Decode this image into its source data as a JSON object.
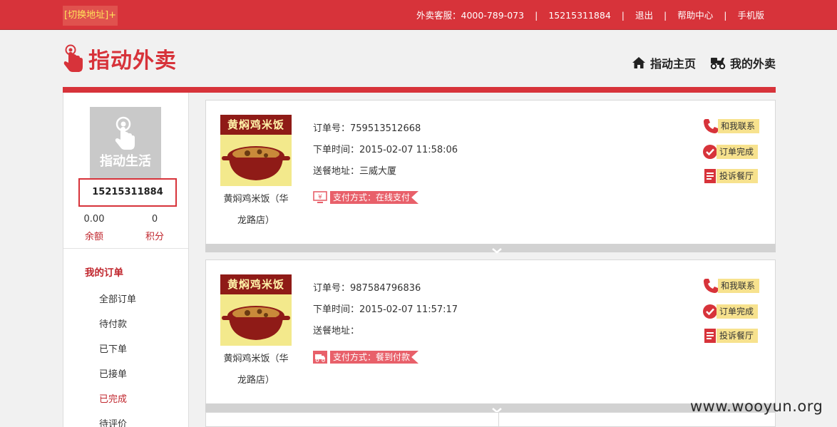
{
  "topbar": {
    "switch_address": "[切换地址]",
    "switch_plus": "+",
    "service_hotline": "外卖客服：4000-789-073",
    "account_phone": "15215311884",
    "logout": "退出",
    "help_center": "帮助中心",
    "mobile_version": "手机版"
  },
  "header": {
    "logo_text": "指动外卖",
    "nav_home": "指动主页",
    "nav_my_takeout": "我的外卖"
  },
  "sidebar": {
    "avatar_text": "指动生活",
    "phone": "15215311884",
    "balance_value": "0.00",
    "balance_label": "余额",
    "points_value": "0",
    "points_label": "积分",
    "menu_title": "我的订单",
    "menu_items": [
      "全部订单",
      "待付款",
      "已下单",
      "已接单",
      "已完成",
      "待评价"
    ],
    "active_item": "已完成"
  },
  "orders": [
    {
      "restaurant_banner": "黄焖鸡米饭",
      "restaurant_name": "黄焖鸡米饭（华龙路店）",
      "order_no": "订单号：759513512668",
      "order_time": "下单时间：2015-02-07 11:58:06",
      "address": "送餐地址：三威大厦",
      "payment": "支付方式：在线支付",
      "payment_icon": "yen-monitor-icon",
      "actions": [
        "和我联系",
        "订单完成",
        "投诉餐厅"
      ]
    },
    {
      "restaurant_banner": "黄焖鸡米饭",
      "restaurant_name": "黄焖鸡米饭（华龙路店）",
      "order_no": "订单号：987584796836",
      "order_time": "下单时间：2015-02-07 11:57:17",
      "address": "送餐地址：",
      "payment": "支付方式：餐到付款",
      "payment_icon": "delivery-truck-icon",
      "actions": [
        "和我联系",
        "订单完成",
        "投诉餐厅"
      ]
    }
  ],
  "watermark": "www.wooyun.org",
  "colors": {
    "brand_red": "#d7333a",
    "accent_text": "#c0262d",
    "action_yellow": "#f7e28e",
    "pay_tag": "#e8606a"
  }
}
